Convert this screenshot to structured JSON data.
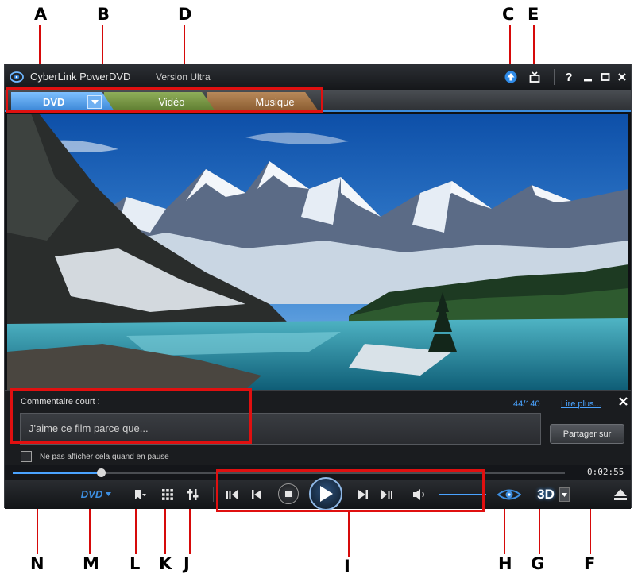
{
  "callouts": {
    "A": "A",
    "B": "B",
    "C": "C",
    "D": "D",
    "E": "E",
    "F": "F",
    "G": "G",
    "H": "H",
    "I": "I",
    "J": "J",
    "K": "K",
    "L": "L",
    "M": "M",
    "N": "N"
  },
  "window": {
    "title": "CyberLink PowerDVD",
    "edition": "Version Ultra",
    "help": "?"
  },
  "tabs": {
    "dvd": "DVD",
    "video": "Vidéo",
    "music": "Musique"
  },
  "comment": {
    "label": "Commentaire court :",
    "counter": "44/140",
    "read_more": "Lire plus...",
    "text": "J'aime ce film parce que...",
    "share_button": "Partager sur",
    "hide_checkbox_label": "Ne pas afficher cela quand en pause",
    "hide_checked": false
  },
  "playback": {
    "elapsed": "0:02:55",
    "progress": 0.16,
    "menu_label": "DVD",
    "threed_label": "3D"
  },
  "colors": {
    "accent": "#3d8ee0",
    "callout_box": "#e01010",
    "tab_dvd": "#4a97e6",
    "tab_video": "#7a9a45",
    "tab_music": "#a87845"
  },
  "icons": {
    "logo": "powerdvd-logo-icon",
    "upgrade": "upgrade-arrow-icon",
    "mini_mode": "mini-mode-icon",
    "help": "help-icon",
    "minimize": "minimize-icon",
    "maximize": "maximize-icon",
    "close": "close-icon",
    "bookmark": "bookmark-icon",
    "grid": "grid-menu-icon",
    "settings": "settings-icon",
    "prev_frame": "step-back-icon",
    "previous": "previous-icon",
    "stop": "stop-icon",
    "play": "play-icon",
    "next": "next-icon",
    "next_frame": "step-forward-icon",
    "volume": "volume-icon",
    "eye": "trueTheater-eye-icon",
    "eject": "eject-icon"
  }
}
